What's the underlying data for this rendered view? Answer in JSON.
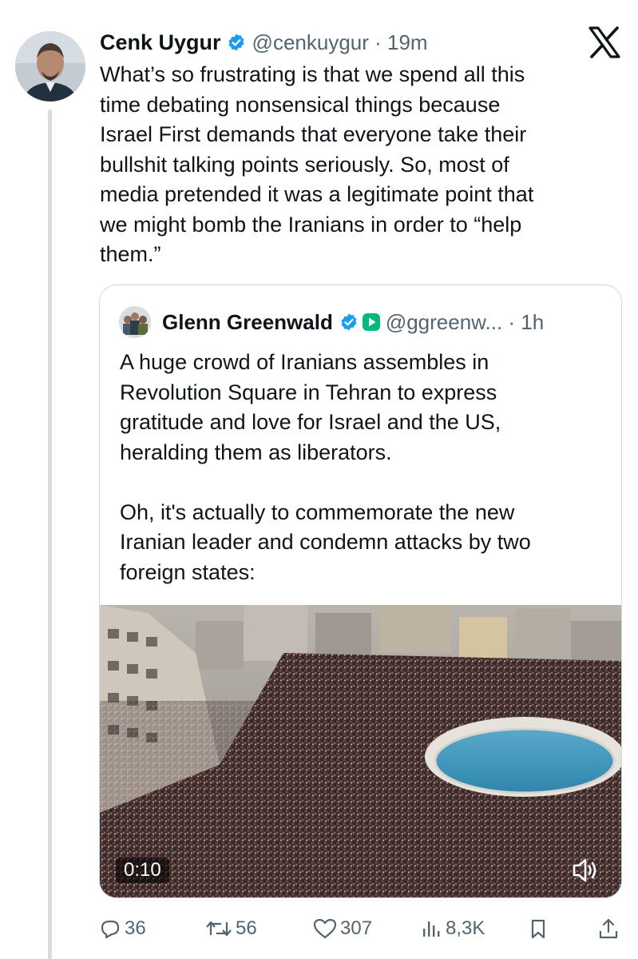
{
  "tweet": {
    "author_name": "Cenk Uygur",
    "handle_time": "@cenkuygur · 19m",
    "text": "What’s so frustrating is that we spend all this\ntime debating nonsensical things because\nIsrael First demands that everyone take their\nbullshit talking points seriously. So, most of\nmedia pretended it was a legitimate point that\nwe might bomb the Iranians in order to “help\nthem.”"
  },
  "quote": {
    "author_name": "Glenn Greenwald",
    "handle_time": "@ggreenw... · 1h",
    "text": "A huge crowd of Iranians assembles in\nRevolution Square in Tehran to express\ngratitude and love for Israel and the US,\nheralding them as liberators.\n\nOh, it's actually to commemorate the new\nIranian leader and condemn attacks by two\nforeign states:",
    "video_duration": "0:10"
  },
  "actions": {
    "replies": "36",
    "reposts": "56",
    "likes": "307",
    "views": "8,3K"
  },
  "icons": {
    "verified": "verified-badge-icon",
    "x_logo": "x-logo-icon",
    "reply": "reply-icon",
    "repost": "repost-icon",
    "like": "heart-icon",
    "views": "views-chart-icon",
    "bookmark": "bookmark-icon",
    "share": "share-icon",
    "mute": "speaker-icon"
  },
  "colors": {
    "verified_blue": "#1d9bf0",
    "secondary_text": "#536471",
    "subscription_green": "#00ba7c"
  }
}
